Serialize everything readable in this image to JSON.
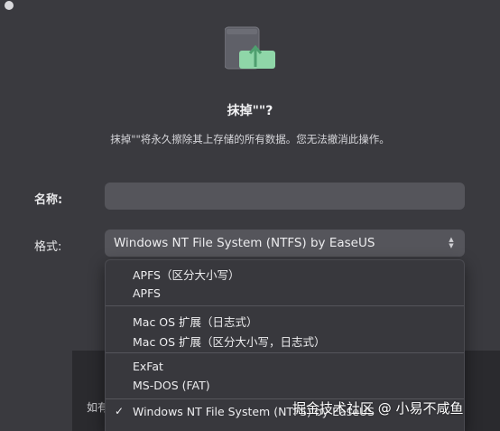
{
  "dialog": {
    "title": "抹掉\"\"?",
    "description": "抹掉\"\"将永久擦除其上存储的所有数据。您无法撤消此操作。"
  },
  "form": {
    "name_label": "名称:",
    "name_value": "",
    "format_label": "格式:",
    "format_value": "Windows NT File System (NTFS) by EaseUS"
  },
  "format_menu": {
    "groups": [
      [
        "APFS（区分大小写）",
        "APFS"
      ],
      [
        "Mac OS 扩展（日志式）",
        "Mac OS 扩展（区分大小写，日志式）"
      ],
      [
        "ExFat",
        "MS-DOS (FAT)"
      ],
      [
        "Windows NT File System (NTFS) by EaseUS"
      ]
    ],
    "selected": "Windows NT File System (NTFS) by EaseUS"
  },
  "background": {
    "hint_text": "如有"
  },
  "watermark": "掘金技术社区 @ 小易不咸鱼",
  "colors": {
    "panel": "#3a3a3f",
    "field": "#55555b",
    "disk_accent": "#8fd6a8"
  }
}
